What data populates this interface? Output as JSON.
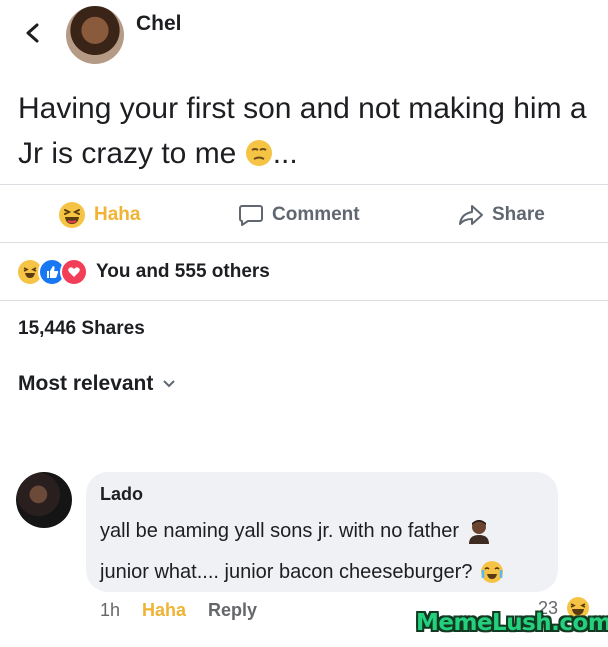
{
  "header": {
    "author_name": "Chel"
  },
  "post": {
    "text": "Having your first son and not making him a Jr is crazy to me",
    "trailing": "..."
  },
  "actions": {
    "haha_label": "Haha",
    "comment_label": "Comment",
    "share_label": "Share"
  },
  "reactions_summary": {
    "text": "You and 555 others"
  },
  "shares": {
    "text": "15,446 Shares"
  },
  "sort": {
    "label": "Most relevant"
  },
  "comment": {
    "author": "Lado",
    "line1": "yall be naming yall sons jr. with no father",
    "line2": "junior what.... junior bacon cheeseburger?",
    "time": "1h",
    "haha_label": "Haha",
    "reply_label": "Reply",
    "reaction_count": "23"
  },
  "watermark": {
    "text": "MemeLush.com"
  },
  "colors": {
    "haha": "#f0b333",
    "like": "#1877f2",
    "love": "#f33e58",
    "muted": "#65676b",
    "bubble": "#eff1f4"
  },
  "icons": {
    "back": "chevron-left-icon",
    "comment": "comment-bubble-icon",
    "share": "share-arrow-icon",
    "haha": "haha-emoji-icon",
    "post_emoji": "unamused-face-emoji",
    "man_emoji": "man-emoji",
    "crying_laughing_emoji": "loudly-crying-face-emoji"
  }
}
